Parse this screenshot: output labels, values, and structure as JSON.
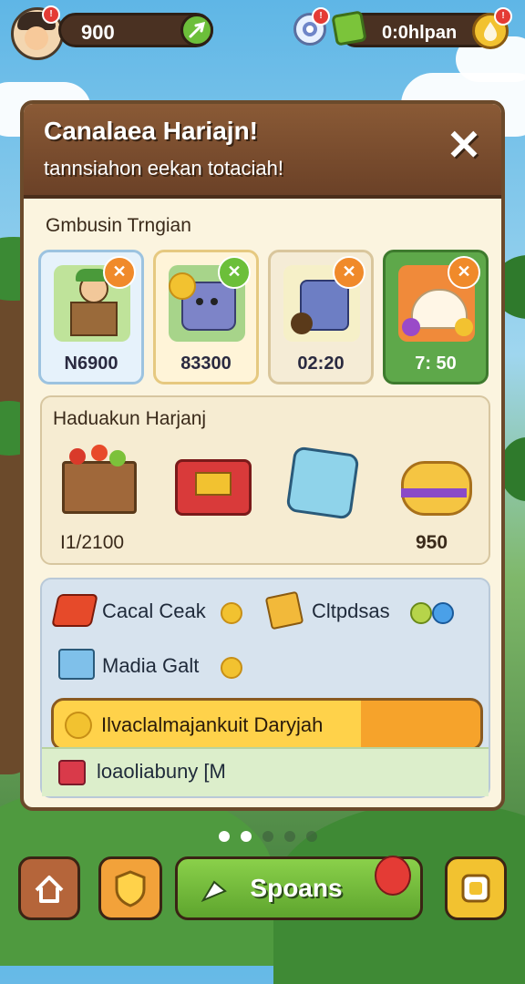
{
  "top_bar": {
    "coin_value": "900",
    "coin_badge": "!",
    "resource_label": "0:0hlpan",
    "resource_badge": "!",
    "gem_badge": "!"
  },
  "panel": {
    "title": "Canalaea Hariajn!",
    "subtitle": "tannsiahon eekan totaciah!",
    "section1_label": "Gmbusin Trngian",
    "cards": [
      {
        "price": "N6900",
        "icon": "farmer-cart-icon"
      },
      {
        "price": "83300",
        "icon": "smiling-cart-icon"
      },
      {
        "price": "02:20",
        "icon": "cart-machine-icon"
      },
      {
        "price": "7: 50",
        "icon": "tent-gems-icon"
      }
    ],
    "section2_label": "Haduakun Harjanj",
    "items_left_value": "I1/2100",
    "items_right_value": "950",
    "items": [
      {
        "icon": "fruit-crate-icon"
      },
      {
        "icon": "red-chest-icon"
      },
      {
        "icon": "blue-cube-icon"
      },
      {
        "icon": "gold-coin-stack-icon"
      }
    ],
    "rewards": [
      {
        "label": "Cacal Ceak",
        "icon": "red-flag-icon"
      },
      {
        "label": "Cltpdsas",
        "icon": "ticket-icon"
      },
      {
        "label": "Madia Galt",
        "icon": "blue-box-icon"
      }
    ],
    "progress_label": "Ilvaclalmajankuit Daryjah",
    "progress_fraction": 0.72,
    "footer_label": "loaoliabuny [M"
  },
  "pager": {
    "count": 5,
    "active": 1
  },
  "bottom_bar": {
    "play_label": "Spoans"
  },
  "colors": {
    "panel_header": "#7a4a2c",
    "accent_orange": "#f6a32b",
    "accent_green": "#6cbf3a",
    "badge_red": "#e43b35"
  }
}
